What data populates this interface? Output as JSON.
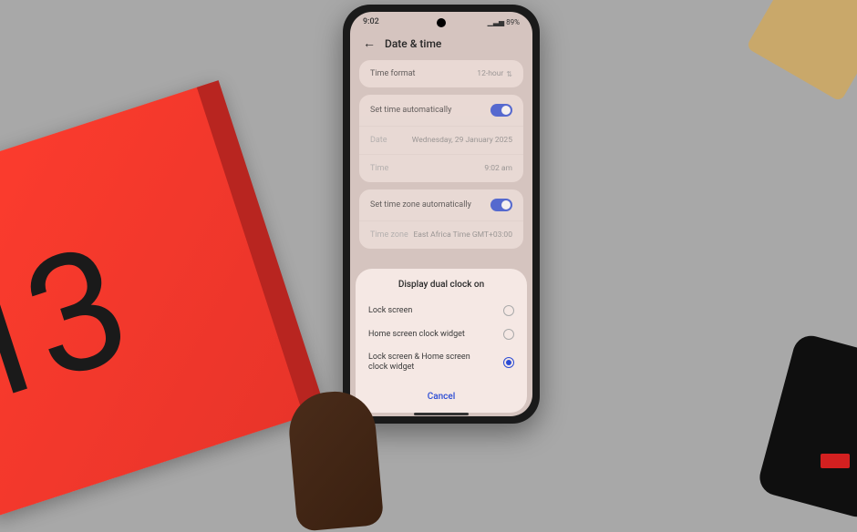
{
  "statusBar": {
    "time": "9:02",
    "battery": "89%"
  },
  "header": {
    "title": "Date & time"
  },
  "settings": {
    "timeFormat": {
      "label": "Time format",
      "value": "12-hour"
    },
    "autoTime": {
      "label": "Set time automatically",
      "enabled": true
    },
    "date": {
      "label": "Date",
      "value": "Wednesday, 29 January 2025"
    },
    "time": {
      "label": "Time",
      "value": "9:02 am"
    },
    "autoTimezone": {
      "label": "Set time zone automatically",
      "enabled": true
    },
    "timezone": {
      "label": "Time zone",
      "value": "East Africa Time GMT+03:00"
    }
  },
  "sheet": {
    "title": "Display dual clock on",
    "options": [
      {
        "label": "Lock screen",
        "selected": false
      },
      {
        "label": "Home screen clock widget",
        "selected": false
      },
      {
        "label": "Lock screen & Home screen clock widget",
        "selected": true
      }
    ],
    "cancel": "Cancel"
  }
}
